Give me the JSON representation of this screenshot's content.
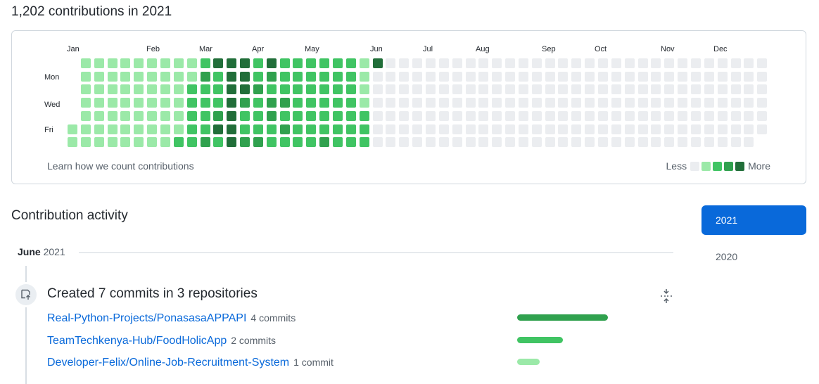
{
  "heading": "1,202 contributions in 2021",
  "calendar": {
    "months": [
      "Jan",
      "Feb",
      "Mar",
      "Apr",
      "May",
      "Jun",
      "Jul",
      "Aug",
      "Sep",
      "Oct",
      "Nov",
      "Dec"
    ],
    "day_labels": [
      "Mon",
      "Wed",
      "Fri"
    ],
    "levels_by_week": [
      "0000011",
      "1111111",
      "1111111",
      "1111111",
      "1111111",
      "1111111",
      "1111111",
      "1111111",
      "1111112",
      "1122222",
      "2322223",
      "4222342",
      "4444444",
      "4443223",
      "2232223",
      "4323322",
      "2223232",
      "2222222",
      "2222222",
      "2222223",
      "2222222",
      "2222222",
      "1111222",
      "4000000"
    ],
    "colors": [
      "#ebedf0",
      "#9be9a8",
      "#40c463",
      "#30a14e",
      "#216e39"
    ],
    "learn_link": "Learn how we count contributions",
    "legend_less": "Less",
    "legend_more": "More"
  },
  "activity": {
    "title": "Contribution activity",
    "years": [
      "2021",
      "2020"
    ],
    "selected_year": "2021",
    "month_name": "June",
    "month_year": "2021",
    "summary": "Created 7 commits in 3 repositories",
    "repos": [
      {
        "name": "Real-Python-Projects/PonasasaAPPAPI",
        "count": "4 commits",
        "commits": 4
      },
      {
        "name": "TeamTechkenya-Hub/FoodHolicApp",
        "count": "2 commits",
        "commits": 2
      },
      {
        "name": "Developer-Felix/Online-Job-Recruitment-System",
        "count": "1 commit",
        "commits": 1
      }
    ]
  }
}
